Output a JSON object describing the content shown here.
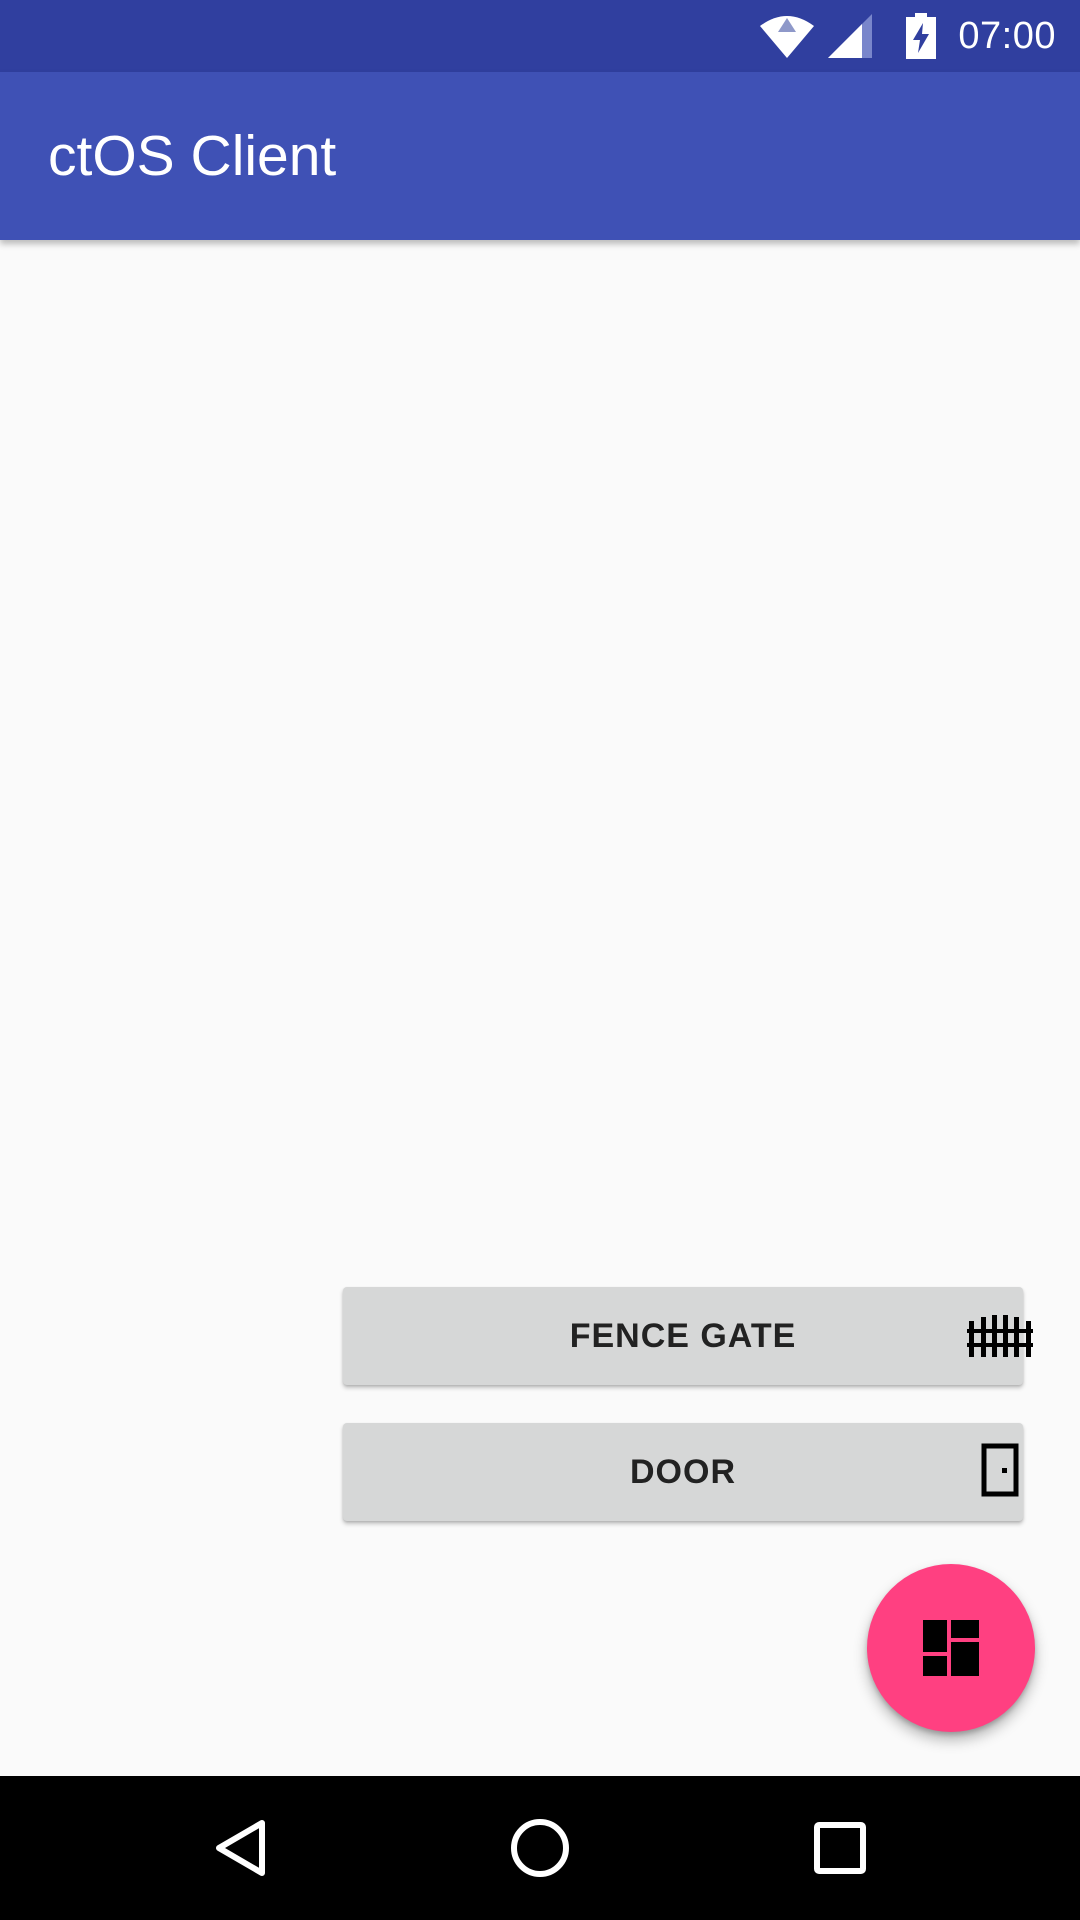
{
  "status_bar": {
    "time": "07:00",
    "icons": [
      "wifi-icon",
      "cell-signal-icon",
      "battery-charging-icon"
    ],
    "background": "#303f9f"
  },
  "app_bar": {
    "title": "ctOS Client",
    "background": "#3f51b5"
  },
  "buttons": [
    {
      "label": "FENCE GATE",
      "icon": "fence-icon"
    },
    {
      "label": "DOOR",
      "icon": "door-icon"
    }
  ],
  "fab": {
    "icon": "dashboard-icon",
    "color": "#ff4081"
  },
  "nav_bar": {
    "items": [
      "back-icon",
      "home-icon",
      "recents-icon"
    ]
  }
}
